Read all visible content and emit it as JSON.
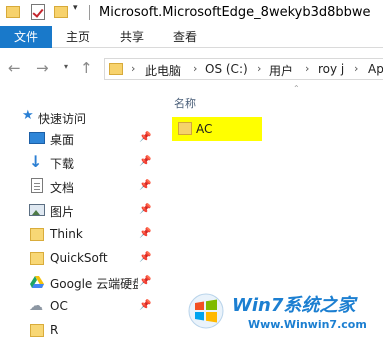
{
  "window": {
    "title": "Microsoft.MicrosoftEdge_8wekyb3d8bbwe"
  },
  "ribbon": {
    "tabs": [
      "文件",
      "主页",
      "共享",
      "查看"
    ]
  },
  "address": {
    "crumbs": [
      "此电脑",
      "OS (C:)",
      "用户",
      "roy j",
      "Ap"
    ]
  },
  "sidebar": {
    "quick_access": "快速访问",
    "items": [
      {
        "label": "桌面",
        "icon": "desktop-icon",
        "pinned": true
      },
      {
        "label": "下载",
        "icon": "download-icon",
        "pinned": true
      },
      {
        "label": "文档",
        "icon": "document-icon",
        "pinned": true
      },
      {
        "label": "图片",
        "icon": "pictures-icon",
        "pinned": true
      },
      {
        "label": "Think",
        "icon": "folder-icon",
        "pinned": true
      },
      {
        "label": "QuickSoft",
        "icon": "folder-icon",
        "pinned": true
      },
      {
        "label": "Google 云端硬盘",
        "icon": "google-drive-icon",
        "pinned": true
      },
      {
        "label": "OC",
        "icon": "cloud-icon",
        "pinned": true
      },
      {
        "label": "R",
        "icon": "folder-icon",
        "pinned": false
      }
    ]
  },
  "content": {
    "column_name": "名称",
    "files": [
      {
        "name": "AC",
        "highlight": "#ffff00"
      }
    ]
  },
  "watermark": {
    "title": "Win7系统之家",
    "url": "Www.Winwin7.com"
  },
  "colors": {
    "file_tab": "#1979ca",
    "highlight": "#ffff00",
    "watermark": "#1c7fd1"
  }
}
